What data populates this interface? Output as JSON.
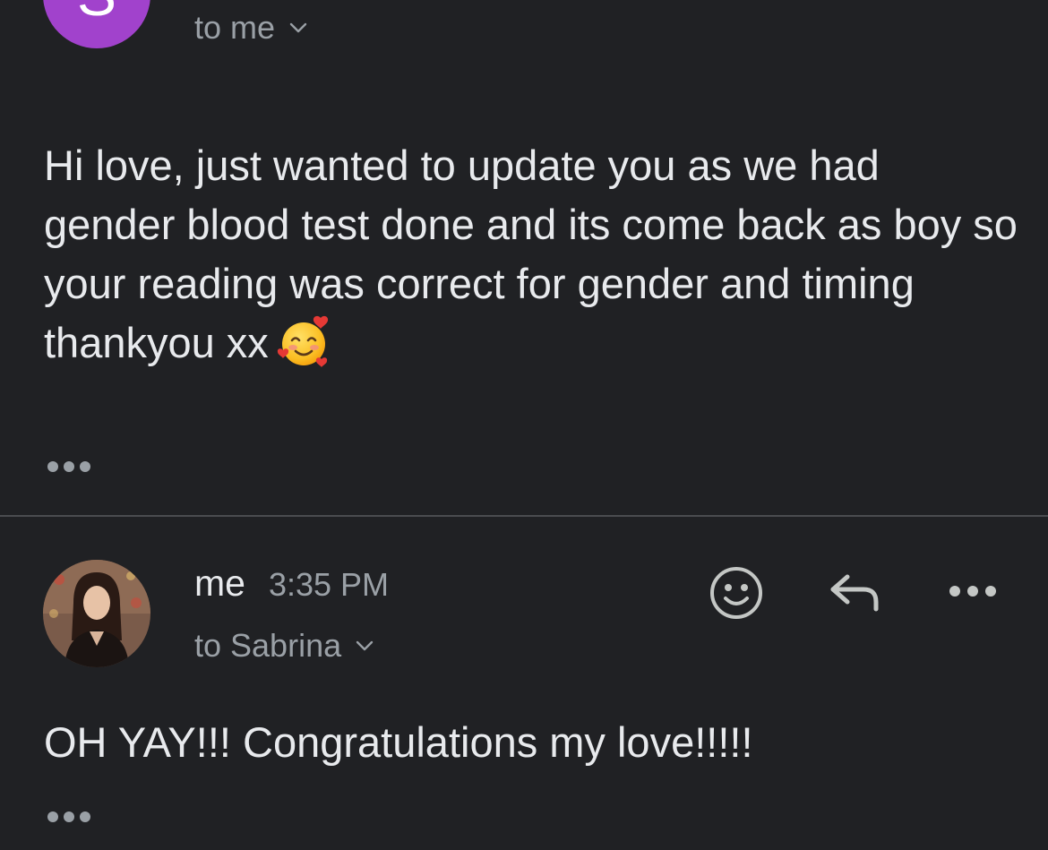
{
  "first_message": {
    "avatar_letter": "S",
    "avatar_color": "#a142cc",
    "recipient_label": "to me",
    "body": "Hi love, just wanted to update you as we had gender blood test done and its come back as boy so your reading was correct for gender and timing thankyou xx",
    "emoji": "smiling-face-with-hearts-emoji"
  },
  "second_message": {
    "sender": "me",
    "time": "3:35 PM",
    "recipient_label": "to Sabrina",
    "body": "OH YAY!!! Congratulations my love!!!!!",
    "actions": [
      "react-icon",
      "reply-icon",
      "more-icon"
    ]
  },
  "colors": {
    "background": "#202124",
    "primary_text": "#e8eaed",
    "secondary_text": "#9aa0a6",
    "divider": "#4a4c50"
  }
}
